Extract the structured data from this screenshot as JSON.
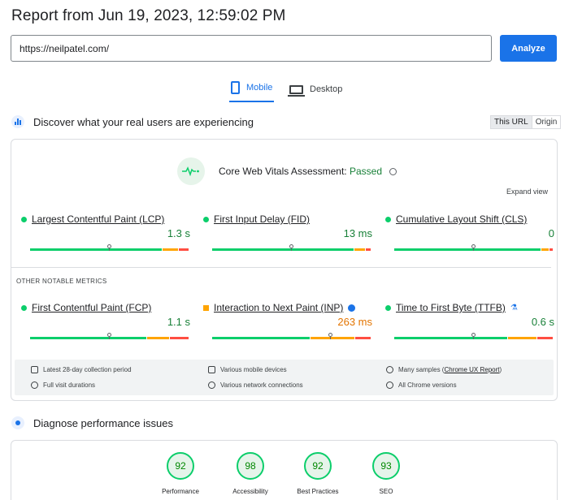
{
  "header": {
    "title": "Report from Jun 19, 2023, 12:59:02 PM"
  },
  "url_input": {
    "value": "https://neilpatel.com/",
    "button_label": "Analyze"
  },
  "tabs": [
    {
      "label": "Mobile",
      "selected": true,
      "icon": "phone-icon"
    },
    {
      "label": "Desktop",
      "selected": false,
      "icon": "laptop-icon"
    }
  ],
  "field_section": {
    "heading": "Discover what your real users are experiencing",
    "toggle": {
      "this_url": "This URL",
      "origin": "Origin",
      "selected": "This URL"
    },
    "assessment_label": "Core Web Vitals Assessment:",
    "assessment_status": "Passed",
    "expand_label": "Expand view",
    "core_metrics": [
      {
        "name": "Largest Contentful Paint (LCP)",
        "value": "1.3 s",
        "status": "good",
        "distribution": [
          0.84,
          0.1,
          0.06
        ],
        "marker": 0.5
      },
      {
        "name": "First Input Delay (FID)",
        "value": "13 ms",
        "status": "good",
        "distribution": [
          0.9,
          0.07,
          0.03
        ],
        "marker": 0.5
      },
      {
        "name": "Cumulative Layout Shift (CLS)",
        "value": "0",
        "status": "good",
        "distribution": [
          0.93,
          0.05,
          0.02
        ],
        "marker": 0.5
      }
    ],
    "other_label": "OTHER NOTABLE METRICS",
    "other_metrics": [
      {
        "name": "First Contentful Paint (FCP)",
        "value": "1.1 s",
        "status": "good",
        "distribution": [
          0.74,
          0.14,
          0.12
        ],
        "marker": 0.5,
        "extra_icon": ""
      },
      {
        "name": "Interaction to Next Paint (INP)",
        "value": "263 ms",
        "status": "needs-improvement",
        "distribution": [
          0.62,
          0.28,
          0.1
        ],
        "marker": 0.75,
        "extra_icon": "info-icon"
      },
      {
        "name": "Time to First Byte (TTFB)",
        "value": "0.6 s",
        "status": "good",
        "distribution": [
          0.72,
          0.18,
          0.1
        ],
        "marker": 0.5,
        "extra_icon": "flask-icon"
      }
    ],
    "info": {
      "collection_period": "Latest 28-day collection period",
      "visit_durations": "Full visit durations",
      "devices": "Various mobile devices",
      "connections": "Various network connections",
      "samples_prefix": "Many samples (",
      "samples_link": "Chrome UX Report",
      "samples_suffix": ")",
      "chrome_versions": "All Chrome versions"
    }
  },
  "lab_section": {
    "heading": "Diagnose performance issues",
    "scores": [
      {
        "label": "Performance",
        "value": "92"
      },
      {
        "label": "Accessibility",
        "value": "98"
      },
      {
        "label": "Best Practices",
        "value": "92"
      },
      {
        "label": "SEO",
        "value": "93"
      }
    ]
  },
  "colors": {
    "accent": "#1a73e8",
    "good": "#0cce6b",
    "average": "#ffa400",
    "poor": "#ff4e42",
    "passed_text": "#188038"
  }
}
